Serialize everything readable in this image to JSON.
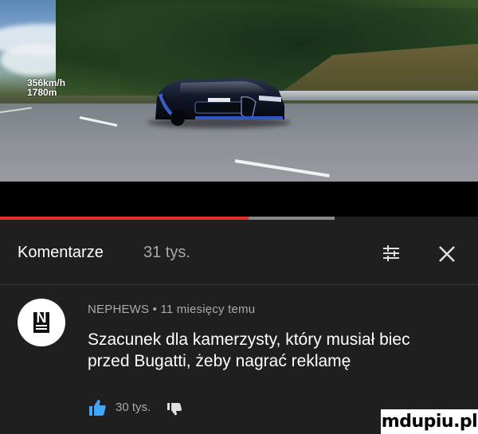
{
  "video": {
    "speed_overlay": "356km/h",
    "distance_overlay": "1780m",
    "progress_percent": 52
  },
  "comments_panel": {
    "title": "Komentarze",
    "count": "31 tys.",
    "sort_icon": "sort-icon",
    "close_icon": "close-icon"
  },
  "comment": {
    "author": "NEPHEWS",
    "separator": "•",
    "age": "11 miesięcy temu",
    "text_line1": "Szacunek dla kamerzysty, który musiał biec",
    "text_line2": "przed Bugatti, żeby nagrać reklamę",
    "likes": "30 tys.",
    "like_icon": "thumbs-up-icon",
    "dislike_icon": "thumbs-down-icon"
  },
  "watermark": "mdupiu.pl",
  "colors": {
    "progress": "#e52d27",
    "background": "#1f1f1f",
    "secondary_text": "#aaaaaa"
  }
}
